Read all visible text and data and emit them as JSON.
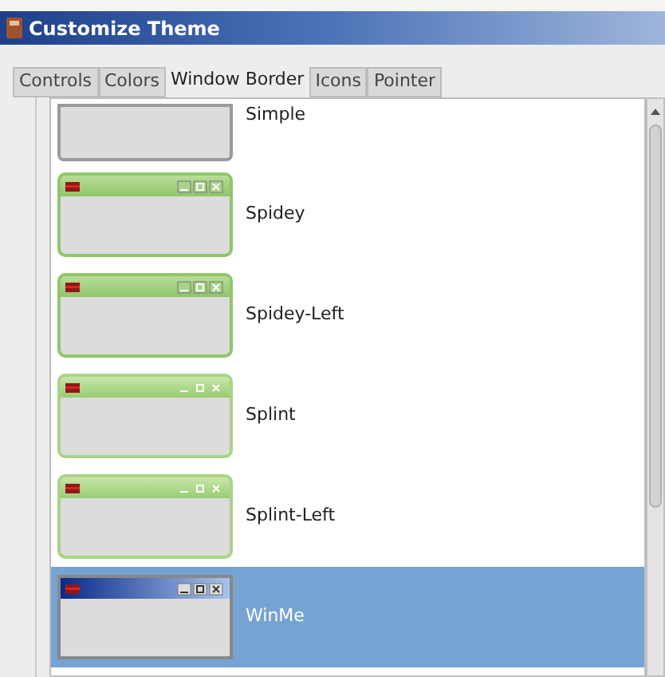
{
  "window": {
    "title": "Customize Theme"
  },
  "tabs": [
    {
      "label": "Controls",
      "selected": false
    },
    {
      "label": "Colors",
      "selected": false
    },
    {
      "label": "Window Border",
      "selected": true
    },
    {
      "label": "Icons",
      "selected": false
    },
    {
      "label": "Pointer",
      "selected": false
    }
  ],
  "themes": [
    {
      "name": "Simple",
      "kind": "plain",
      "selected": false
    },
    {
      "name": "Spidey",
      "kind": "spidey",
      "selected": false
    },
    {
      "name": "Spidey-Left",
      "kind": "spidey",
      "selected": false
    },
    {
      "name": "Splint",
      "kind": "splint",
      "selected": false
    },
    {
      "name": "Splint-Left",
      "kind": "splint",
      "selected": false
    },
    {
      "name": "WinMe",
      "kind": "winme",
      "selected": true
    }
  ]
}
